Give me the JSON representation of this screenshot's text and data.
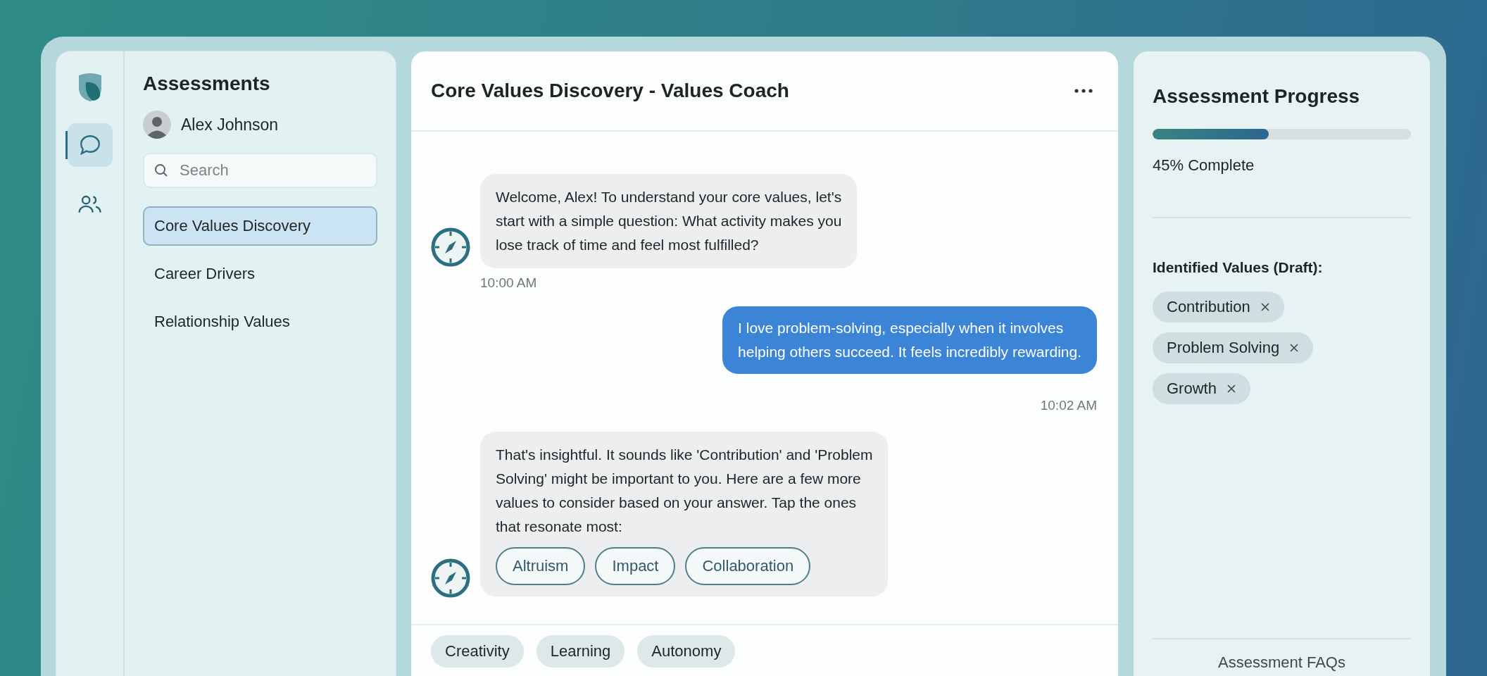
{
  "sidebar": {
    "rail": [
      {
        "kind": "chat",
        "selected": true
      },
      {
        "kind": "people",
        "selected": false
      }
    ],
    "title": "Assessments",
    "user": {
      "name": "Alex Johnson"
    },
    "search": {
      "placeholder": "Search"
    },
    "items": [
      {
        "label": "Core Values Discovery",
        "selected": true
      },
      {
        "label": "Career Drivers",
        "selected": false
      },
      {
        "label": "Relationship Values",
        "selected": false
      }
    ]
  },
  "chat": {
    "title": "Core Values Discovery - Values Coach",
    "messages": [
      {
        "kind": "bot",
        "text": "Welcome, Alex! To understand your core values, let's\nstart with a simple question: What activity makes you\nlose track of time and feel most fulfilled?",
        "time": "10:00 AM"
      },
      {
        "kind": "user",
        "text": "I love problem-solving, especially when it involves\nhelping others succeed. It feels incredibly rewarding.",
        "time": "10:02 AM"
      },
      {
        "kind": "bot",
        "text": "That's insightful. It sounds like 'Contribution' and 'Problem\nSolving' might be important to you. Here are a few more\nvalues to consider based on your answer. Tap the ones\nthat resonate most:",
        "options": [
          "Altruism",
          "Impact",
          "Collaboration"
        ]
      }
    ],
    "suggestions": [
      "Creativity",
      "Learning",
      "Autonomy"
    ]
  },
  "progress": {
    "title": "Assessment Progress",
    "level": 0.45,
    "reading": "45% Complete",
    "values_title": "Identified Values (Draft):",
    "values": [
      "Contribution",
      "Problem Solving",
      "Growth"
    ],
    "faq_link": "Assessment FAQs"
  }
}
